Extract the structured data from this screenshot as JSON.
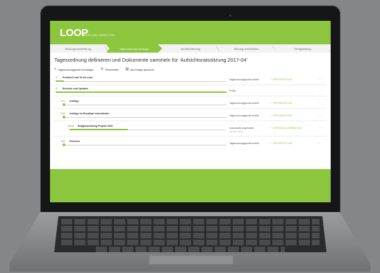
{
  "app": {
    "logo": "LOOP",
    "logo_sub": "MEETING DIRECTOR"
  },
  "steps": [
    {
      "label": "Sitzungsvorbereitung",
      "active": false
    },
    {
      "label": "Tagesordnung festlegen",
      "active": true
    },
    {
      "label": "Veröffentlichung",
      "active": false
    },
    {
      "label": "Sitzung durchführen",
      "active": false
    },
    {
      "label": "Fertigstellung",
      "active": false
    }
  ],
  "page": {
    "title": "Tagesordnung definieren und Dokumente sammeln für 'Aufsichtsratssitzung 2017-04'"
  },
  "toolbar": {
    "add": "Tagesordnungspunkt hinzufügen",
    "topics": "Themenliste",
    "template": "Als Vorlage speichern",
    "icons": {
      "add": "plus-icon",
      "topics": "refresh-icon",
      "template": "document-icon"
    }
  },
  "agenda": [
    {
      "num": "1",
      "label": "Protokoll und To Do Liste",
      "status": "Tagesordnungspunkt erstellt",
      "sub": "",
      "action": "+ FERTIGSTELLEN",
      "progress": 0.05
    },
    {
      "num": "2",
      "label": "Berichte und Updates",
      "status": "Fertig",
      "sub": "",
      "action": "",
      "progress": 1.0
    },
    {
      "num": "2.1",
      "label": "Anträge",
      "status": "Tagesordnungspunkt erstellt",
      "sub": "",
      "action": "+ FERTIGSTELLEN",
      "progress": 0.05
    },
    {
      "num": "2.2",
      "label": "Anträge im Rundlauf entschieden",
      "status": "Tagesordnungspunkt erstellt",
      "sub": "",
      "action": "+ FERTIGSTELLEN",
      "progress": 0.05
    },
    {
      "num": "2.2.1",
      "label": "Budgetzuteilung Projekt 2020",
      "status": "Dokumente angefordert",
      "sub": "Thomas Strehl",
      "action": "+ LIEFERUNG VERWALTEN",
      "progress": 0.45
    },
    {
      "num": "2.3",
      "label": "Diverses",
      "status": "Tagesordnungspunkt erstellt",
      "sub": "",
      "action": "+ FERTIGSTELLEN",
      "progress": 0.05
    }
  ],
  "colors": {
    "accent": "#8cc63f"
  }
}
